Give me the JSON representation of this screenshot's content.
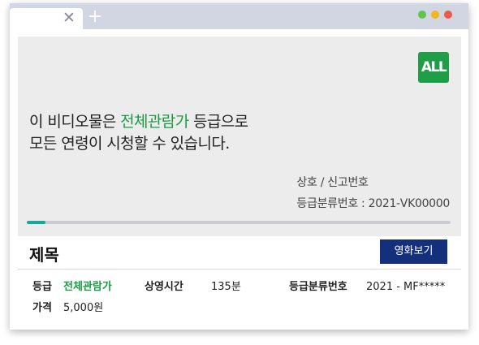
{
  "colors": {
    "accent_green": "#1a9a44",
    "badge_green": "#1e9e46",
    "progress_teal": "#17a89a",
    "button_navy": "#15307a",
    "dot_green": "#62c54a",
    "dot_yellow": "#f2b51c",
    "dot_red": "#ea5b48"
  },
  "browser": {
    "close_icon": "close-icon",
    "close_glyph": "✕",
    "add_icon": "plus-icon",
    "add_glyph": "+"
  },
  "player": {
    "rating_badge": "ALL",
    "notice_line1_pre": "이 비디오물은 ",
    "notice_line1_highlight": "전체관람가",
    "notice_line1_post": " 등급으로",
    "notice_line2": "모든 연령이 시청할 수 있습니다.",
    "meta_line1": "상호 / 신고번호",
    "meta_line2": "등급분류번호 : 2021-VK00000",
    "progress_fraction": 0.045
  },
  "details": {
    "title": "제목",
    "watch_button": "영화보기",
    "rating_label": "등급",
    "rating_value": "전체관람가",
    "runtime_label": "상영시간",
    "runtime_value": "135분",
    "classification_label": "등급분류번호",
    "classification_value": "2021 - MF*****",
    "price_label": "가격",
    "price_value": "5,000원"
  }
}
